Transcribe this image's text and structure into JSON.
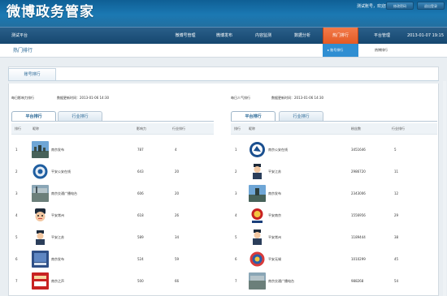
{
  "header": {
    "title": "微博政务管家",
    "welcome": "测试账号，欢迎您！",
    "btn_account": "修改密码",
    "btn_logout": "退出登录"
  },
  "nav": {
    "left_label": "测试平台",
    "items": [
      "微博号管理",
      "微博发布",
      "内容监测",
      "数据分析",
      "热门排行",
      "平台管理"
    ],
    "date": "2013-01-07 19:15"
  },
  "subnav": {
    "title": "热门排行",
    "active": "账号排行",
    "other": "热博排行"
  },
  "main_tab": "账号排行",
  "left": {
    "title": "每日影响力排行",
    "updated": "数据更新时间：2013-01-06 14:30",
    "subtabs": [
      "平台排行",
      "行业排行"
    ],
    "columns": [
      "排行",
      "昵称",
      "影响力",
      "行业排行"
    ],
    "rows": [
      {
        "rank": "1",
        "name": "南京发布",
        "value": "787",
        "ind": "4",
        "av": "a1"
      },
      {
        "rank": "2",
        "name": "平安公安在线",
        "value": "643",
        "ind": "20",
        "av": "a2"
      },
      {
        "rank": "3",
        "name": "南京交通广播电台",
        "value": "606",
        "ind": "20",
        "av": "a3"
      },
      {
        "rank": "4",
        "name": "平安常州",
        "value": "618",
        "ind": "26",
        "av": "a4"
      },
      {
        "rank": "5",
        "name": "平安江苏",
        "value": "589",
        "ind": "34",
        "av": "a5"
      },
      {
        "rank": "6",
        "name": "南京发布",
        "value": "524",
        "ind": "59",
        "av": "a6"
      },
      {
        "rank": "7",
        "name": "南京之声",
        "value": "500",
        "ind": "66",
        "av": "a7"
      }
    ]
  },
  "right": {
    "title": "每日人气排行",
    "updated": "数据更新时间：2013-01-06 14:30",
    "subtabs": [
      "平台排行",
      "行业排行"
    ],
    "columns": [
      "排行",
      "昵称",
      "粉丝数",
      "行业排行"
    ],
    "rows": [
      {
        "rank": "1",
        "name": "南京公安在线",
        "value": "3451646",
        "ind": "5",
        "av": "b1"
      },
      {
        "rank": "2",
        "name": "平安江苏",
        "value": "2986720",
        "ind": "11",
        "av": "b2"
      },
      {
        "rank": "3",
        "name": "南京发布",
        "value": "2343006",
        "ind": "12",
        "av": "b3"
      },
      {
        "rank": "4",
        "name": "平安南京",
        "value": "1556956",
        "ind": "29",
        "av": "b4"
      },
      {
        "rank": "5",
        "name": "平安常州",
        "value": "1189444",
        "ind": "38",
        "av": "b5"
      },
      {
        "rank": "6",
        "name": "平安无锡",
        "value": "1010299",
        "ind": "45",
        "av": "b6"
      },
      {
        "rank": "7",
        "name": "南京交通广播电台",
        "value": "988268",
        "ind": "54",
        "av": "b7"
      }
    ]
  },
  "colors": {
    "brand_blue": "#1b79b3",
    "nav_active": "#e8622d",
    "dropdown": "#2f8ed2"
  }
}
